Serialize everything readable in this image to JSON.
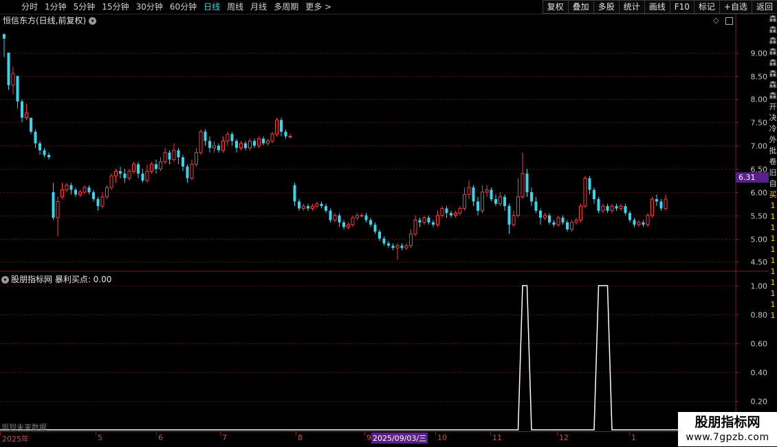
{
  "toolbar": {
    "periods": [
      "分时",
      "1分钟",
      "5分钟",
      "15分钟",
      "30分钟",
      "60分钟",
      "日线",
      "周线",
      "月线",
      "多周期",
      "更多"
    ],
    "active_period": "日线",
    "more_arrow": ">",
    "buttons": [
      "复权",
      "叠加",
      "多股",
      "统计",
      "画线",
      "F10",
      "标记",
      "+自选",
      "返回"
    ]
  },
  "main_chart": {
    "title": "恒信东方(日线,前复权)",
    "current_price_tag": "6.31",
    "y_ticks": [
      "9.00",
      "8.50",
      "8.00",
      "7.50",
      "7.00",
      "6.50",
      "6.00",
      "5.50",
      "5.00",
      "4.50"
    ]
  },
  "indicator": {
    "title": "股朋指标网  暴利买点: 0.00",
    "y_ticks": [
      "1.00",
      "0.80",
      "0.60",
      "0.40",
      "0.20"
    ]
  },
  "date_axis": {
    "labels": [
      "2025年",
      "5",
      "6",
      "7",
      "8",
      "9",
      "10",
      "11",
      "12",
      "1"
    ],
    "selected_date": "2025/09/03/三"
  },
  "warning_text": "用到未来数据",
  "watermark": {
    "line1": "股朋指标网",
    "line2": "www.7gpzb.com"
  },
  "right_strip_chars": [
    "森",
    "森",
    "森",
    "森",
    "森",
    "森",
    "森",
    "森",
    "开",
    "决",
    "冷",
    "外",
    "批",
    "卷",
    "旧",
    "自",
    "买",
    "1",
    "1",
    "1",
    "1",
    "1",
    "1",
    "1",
    "1",
    "1",
    "1",
    "1"
  ],
  "colors": {
    "up": "#ff3b3b",
    "down": "#35d6f0",
    "grid": "#5a1010",
    "border": "#8a1a1a",
    "selected": "#5a1f8a"
  },
  "chart_data": [
    {
      "type": "candlestick",
      "title": "恒信东方(日线,前复权)",
      "ylim": [
        4.3,
        9.6
      ],
      "note": "daily OHLC, approximate readings",
      "candles": [
        [
          9.4,
          9.3,
          8.9,
          9.4
        ],
        [
          9.0,
          8.3,
          8.2,
          9.0
        ],
        [
          8.3,
          8.55,
          8.1,
          8.7
        ],
        [
          8.5,
          7.95,
          7.8,
          8.5
        ],
        [
          7.95,
          7.6,
          7.5,
          8.0
        ],
        [
          7.6,
          7.7,
          7.55,
          7.9
        ],
        [
          7.6,
          7.3,
          7.25,
          7.6
        ],
        [
          7.3,
          7.05,
          6.95,
          7.35
        ],
        [
          7.05,
          6.9,
          6.8,
          7.1
        ],
        [
          6.9,
          6.8,
          6.75,
          6.95
        ],
        [
          6.8,
          6.75,
          6.7,
          6.85
        ],
        [
          6.0,
          5.45,
          5.4,
          6.2
        ],
        [
          5.45,
          5.8,
          5.05,
          5.9
        ],
        [
          5.9,
          6.05,
          5.85,
          6.2
        ],
        [
          6.05,
          6.15,
          6.0,
          6.2
        ],
        [
          6.15,
          6.05,
          5.95,
          6.2
        ],
        [
          6.05,
          5.95,
          5.9,
          6.1
        ],
        [
          5.95,
          6.0,
          5.9,
          6.05
        ],
        [
          6.0,
          6.1,
          5.95,
          6.15
        ],
        [
          6.1,
          6.0,
          5.95,
          6.15
        ],
        [
          6.0,
          5.85,
          5.8,
          6.05
        ],
        [
          5.85,
          5.7,
          5.6,
          5.9
        ],
        [
          5.7,
          5.9,
          5.65,
          6.0
        ],
        [
          5.9,
          6.1,
          5.85,
          6.15
        ],
        [
          6.1,
          6.35,
          6.05,
          6.4
        ],
        [
          6.35,
          6.45,
          6.2,
          6.5
        ],
        [
          6.45,
          6.4,
          6.3,
          6.55
        ],
        [
          6.4,
          6.3,
          6.2,
          6.5
        ],
        [
          6.3,
          6.45,
          6.25,
          6.5
        ],
        [
          6.45,
          6.6,
          6.4,
          6.65
        ],
        [
          6.6,
          6.4,
          6.3,
          6.65
        ],
        [
          6.4,
          6.25,
          6.2,
          6.5
        ],
        [
          6.25,
          6.45,
          6.2,
          6.6
        ],
        [
          6.45,
          6.6,
          6.4,
          6.65
        ],
        [
          6.6,
          6.5,
          6.4,
          6.7
        ],
        [
          6.5,
          6.65,
          6.45,
          6.75
        ],
        [
          6.65,
          6.85,
          6.6,
          6.95
        ],
        [
          6.85,
          6.7,
          6.6,
          6.9
        ],
        [
          6.7,
          6.9,
          6.65,
          7.05
        ],
        [
          6.9,
          6.75,
          6.6,
          6.95
        ],
        [
          6.75,
          6.55,
          6.45,
          6.8
        ],
        [
          6.55,
          6.3,
          6.2,
          6.6
        ],
        [
          6.3,
          6.6,
          6.25,
          6.7
        ],
        [
          6.6,
          6.85,
          6.55,
          6.95
        ],
        [
          6.85,
          7.3,
          6.8,
          7.35
        ],
        [
          7.3,
          7.1,
          7.0,
          7.35
        ],
        [
          7.1,
          6.95,
          6.85,
          7.2
        ],
        [
          6.95,
          7.0,
          6.85,
          7.1
        ],
        [
          7.0,
          6.9,
          6.85,
          7.05
        ],
        [
          6.9,
          7.1,
          6.85,
          7.2
        ],
        [
          7.1,
          7.25,
          7.0,
          7.3
        ],
        [
          7.25,
          7.1,
          7.0,
          7.3
        ],
        [
          7.1,
          6.95,
          6.85,
          7.15
        ],
        [
          6.95,
          7.05,
          6.9,
          7.1
        ],
        [
          7.05,
          6.95,
          6.9,
          7.1
        ],
        [
          6.95,
          7.1,
          6.9,
          7.15
        ],
        [
          7.1,
          7.0,
          6.95,
          7.15
        ],
        [
          7.0,
          7.15,
          6.95,
          7.2
        ],
        [
          7.15,
          7.05,
          7.0,
          7.2
        ],
        [
          7.05,
          7.1,
          7.0,
          7.15
        ],
        [
          7.1,
          7.25,
          7.05,
          7.3
        ],
        [
          7.25,
          7.55,
          7.2,
          7.6
        ],
        [
          7.55,
          7.3,
          7.2,
          7.6
        ],
        [
          7.3,
          7.2,
          7.15,
          7.35
        ],
        [
          7.2,
          7.2,
          7.15,
          7.25
        ],
        [
          6.15,
          5.8,
          5.7,
          6.2
        ],
        [
          5.8,
          5.65,
          5.6,
          5.85
        ],
        [
          5.65,
          5.7,
          5.6,
          5.75
        ],
        [
          5.7,
          5.65,
          5.6,
          5.75
        ],
        [
          5.65,
          5.7,
          5.6,
          5.75
        ],
        [
          5.7,
          5.75,
          5.65,
          5.8
        ],
        [
          5.75,
          5.7,
          5.65,
          5.8
        ],
        [
          5.7,
          5.6,
          5.55,
          5.75
        ],
        [
          5.6,
          5.4,
          5.35,
          5.65
        ],
        [
          5.4,
          5.5,
          5.35,
          5.55
        ],
        [
          5.5,
          5.35,
          5.25,
          5.55
        ],
        [
          5.35,
          5.25,
          5.2,
          5.4
        ],
        [
          5.25,
          5.3,
          5.2,
          5.35
        ],
        [
          5.3,
          5.45,
          5.25,
          5.5
        ],
        [
          5.45,
          5.5,
          5.4,
          5.55
        ],
        [
          5.5,
          5.5,
          5.45,
          5.55
        ],
        [
          5.5,
          5.4,
          5.35,
          5.55
        ],
        [
          5.4,
          5.3,
          5.25,
          5.45
        ],
        [
          5.3,
          5.15,
          5.1,
          5.35
        ],
        [
          5.15,
          5.0,
          4.95,
          5.2
        ],
        [
          5.0,
          4.9,
          4.85,
          5.05
        ],
        [
          4.9,
          4.85,
          4.8,
          4.95
        ],
        [
          4.85,
          4.8,
          4.75,
          4.9
        ],
        [
          4.8,
          4.85,
          4.55,
          4.9
        ],
        [
          4.85,
          4.8,
          4.75,
          4.9
        ],
        [
          4.8,
          4.85,
          4.75,
          4.9
        ],
        [
          4.85,
          5.1,
          4.8,
          5.2
        ],
        [
          5.1,
          5.4,
          5.05,
          5.5
        ],
        [
          5.4,
          5.35,
          5.25,
          5.45
        ],
        [
          5.35,
          5.45,
          5.3,
          5.5
        ],
        [
          5.45,
          5.35,
          5.3,
          5.5
        ],
        [
          5.35,
          5.3,
          5.25,
          5.4
        ],
        [
          5.3,
          5.5,
          5.25,
          5.6
        ],
        [
          5.5,
          5.65,
          5.45,
          5.7
        ],
        [
          5.65,
          5.55,
          5.45,
          5.7
        ],
        [
          5.55,
          5.5,
          5.45,
          5.6
        ],
        [
          5.5,
          5.55,
          5.45,
          5.6
        ],
        [
          5.55,
          5.65,
          5.5,
          5.7
        ],
        [
          5.65,
          5.95,
          5.6,
          6.1
        ],
        [
          5.95,
          6.1,
          5.85,
          6.25
        ],
        [
          6.1,
          5.8,
          5.7,
          6.15
        ],
        [
          5.8,
          5.6,
          5.5,
          5.9
        ],
        [
          5.6,
          6.0,
          5.55,
          6.15
        ],
        [
          6.0,
          6.05,
          5.9,
          6.15
        ],
        [
          6.05,
          5.85,
          5.8,
          6.1
        ],
        [
          5.85,
          5.75,
          5.7,
          5.95
        ],
        [
          5.75,
          5.9,
          5.7,
          6.0
        ],
        [
          5.9,
          5.7,
          5.6,
          5.95
        ],
        [
          5.7,
          5.3,
          5.1,
          5.75
        ],
        [
          5.3,
          5.5,
          5.25,
          5.6
        ],
        [
          5.5,
          5.9,
          5.45,
          6.3
        ],
        [
          5.9,
          6.4,
          5.85,
          6.85
        ],
        [
          6.4,
          6.0,
          5.9,
          6.5
        ],
        [
          6.0,
          5.8,
          5.7,
          6.1
        ],
        [
          5.8,
          5.6,
          5.55,
          5.9
        ],
        [
          5.6,
          5.45,
          5.3,
          5.65
        ],
        [
          5.45,
          5.5,
          5.4,
          5.55
        ],
        [
          5.5,
          5.35,
          5.3,
          5.55
        ],
        [
          5.35,
          5.3,
          5.25,
          5.4
        ],
        [
          5.3,
          5.45,
          5.25,
          5.5
        ],
        [
          5.45,
          5.35,
          5.3,
          5.5
        ],
        [
          5.35,
          5.2,
          5.15,
          5.4
        ],
        [
          5.2,
          5.35,
          5.15,
          5.4
        ],
        [
          5.35,
          5.4,
          5.3,
          5.45
        ],
        [
          5.4,
          5.7,
          5.35,
          5.75
        ],
        [
          5.7,
          6.3,
          5.65,
          6.35
        ],
        [
          6.3,
          6.05,
          5.95,
          6.35
        ],
        [
          6.05,
          5.85,
          5.75,
          6.1
        ],
        [
          5.85,
          5.6,
          5.55,
          5.9
        ],
        [
          5.6,
          5.7,
          5.55,
          5.75
        ],
        [
          5.7,
          5.6,
          5.55,
          5.75
        ],
        [
          5.6,
          5.7,
          5.55,
          5.75
        ],
        [
          5.7,
          5.65,
          5.6,
          5.75
        ],
        [
          5.65,
          5.7,
          5.6,
          5.75
        ],
        [
          5.7,
          5.55,
          5.5,
          5.75
        ],
        [
          5.55,
          5.4,
          5.35,
          5.6
        ],
        [
          5.4,
          5.3,
          5.25,
          5.45
        ],
        [
          5.3,
          5.35,
          5.25,
          5.4
        ],
        [
          5.35,
          5.3,
          5.25,
          5.4
        ],
        [
          5.3,
          5.5,
          5.25,
          5.55
        ],
        [
          5.5,
          5.85,
          5.45,
          5.9
        ],
        [
          5.85,
          5.8,
          5.7,
          5.95
        ],
        [
          5.8,
          5.65,
          5.6,
          5.85
        ],
        [
          5.65,
          5.85,
          5.6,
          5.95
        ]
      ]
    },
    {
      "type": "line",
      "title": "暴利买点",
      "ylim": [
        0,
        1.05
      ],
      "signal_days": [
        [
          116,
          117
        ],
        [
          133,
          134,
          135
        ]
      ],
      "signal_value": 1.0,
      "baseline": 0.0
    }
  ]
}
